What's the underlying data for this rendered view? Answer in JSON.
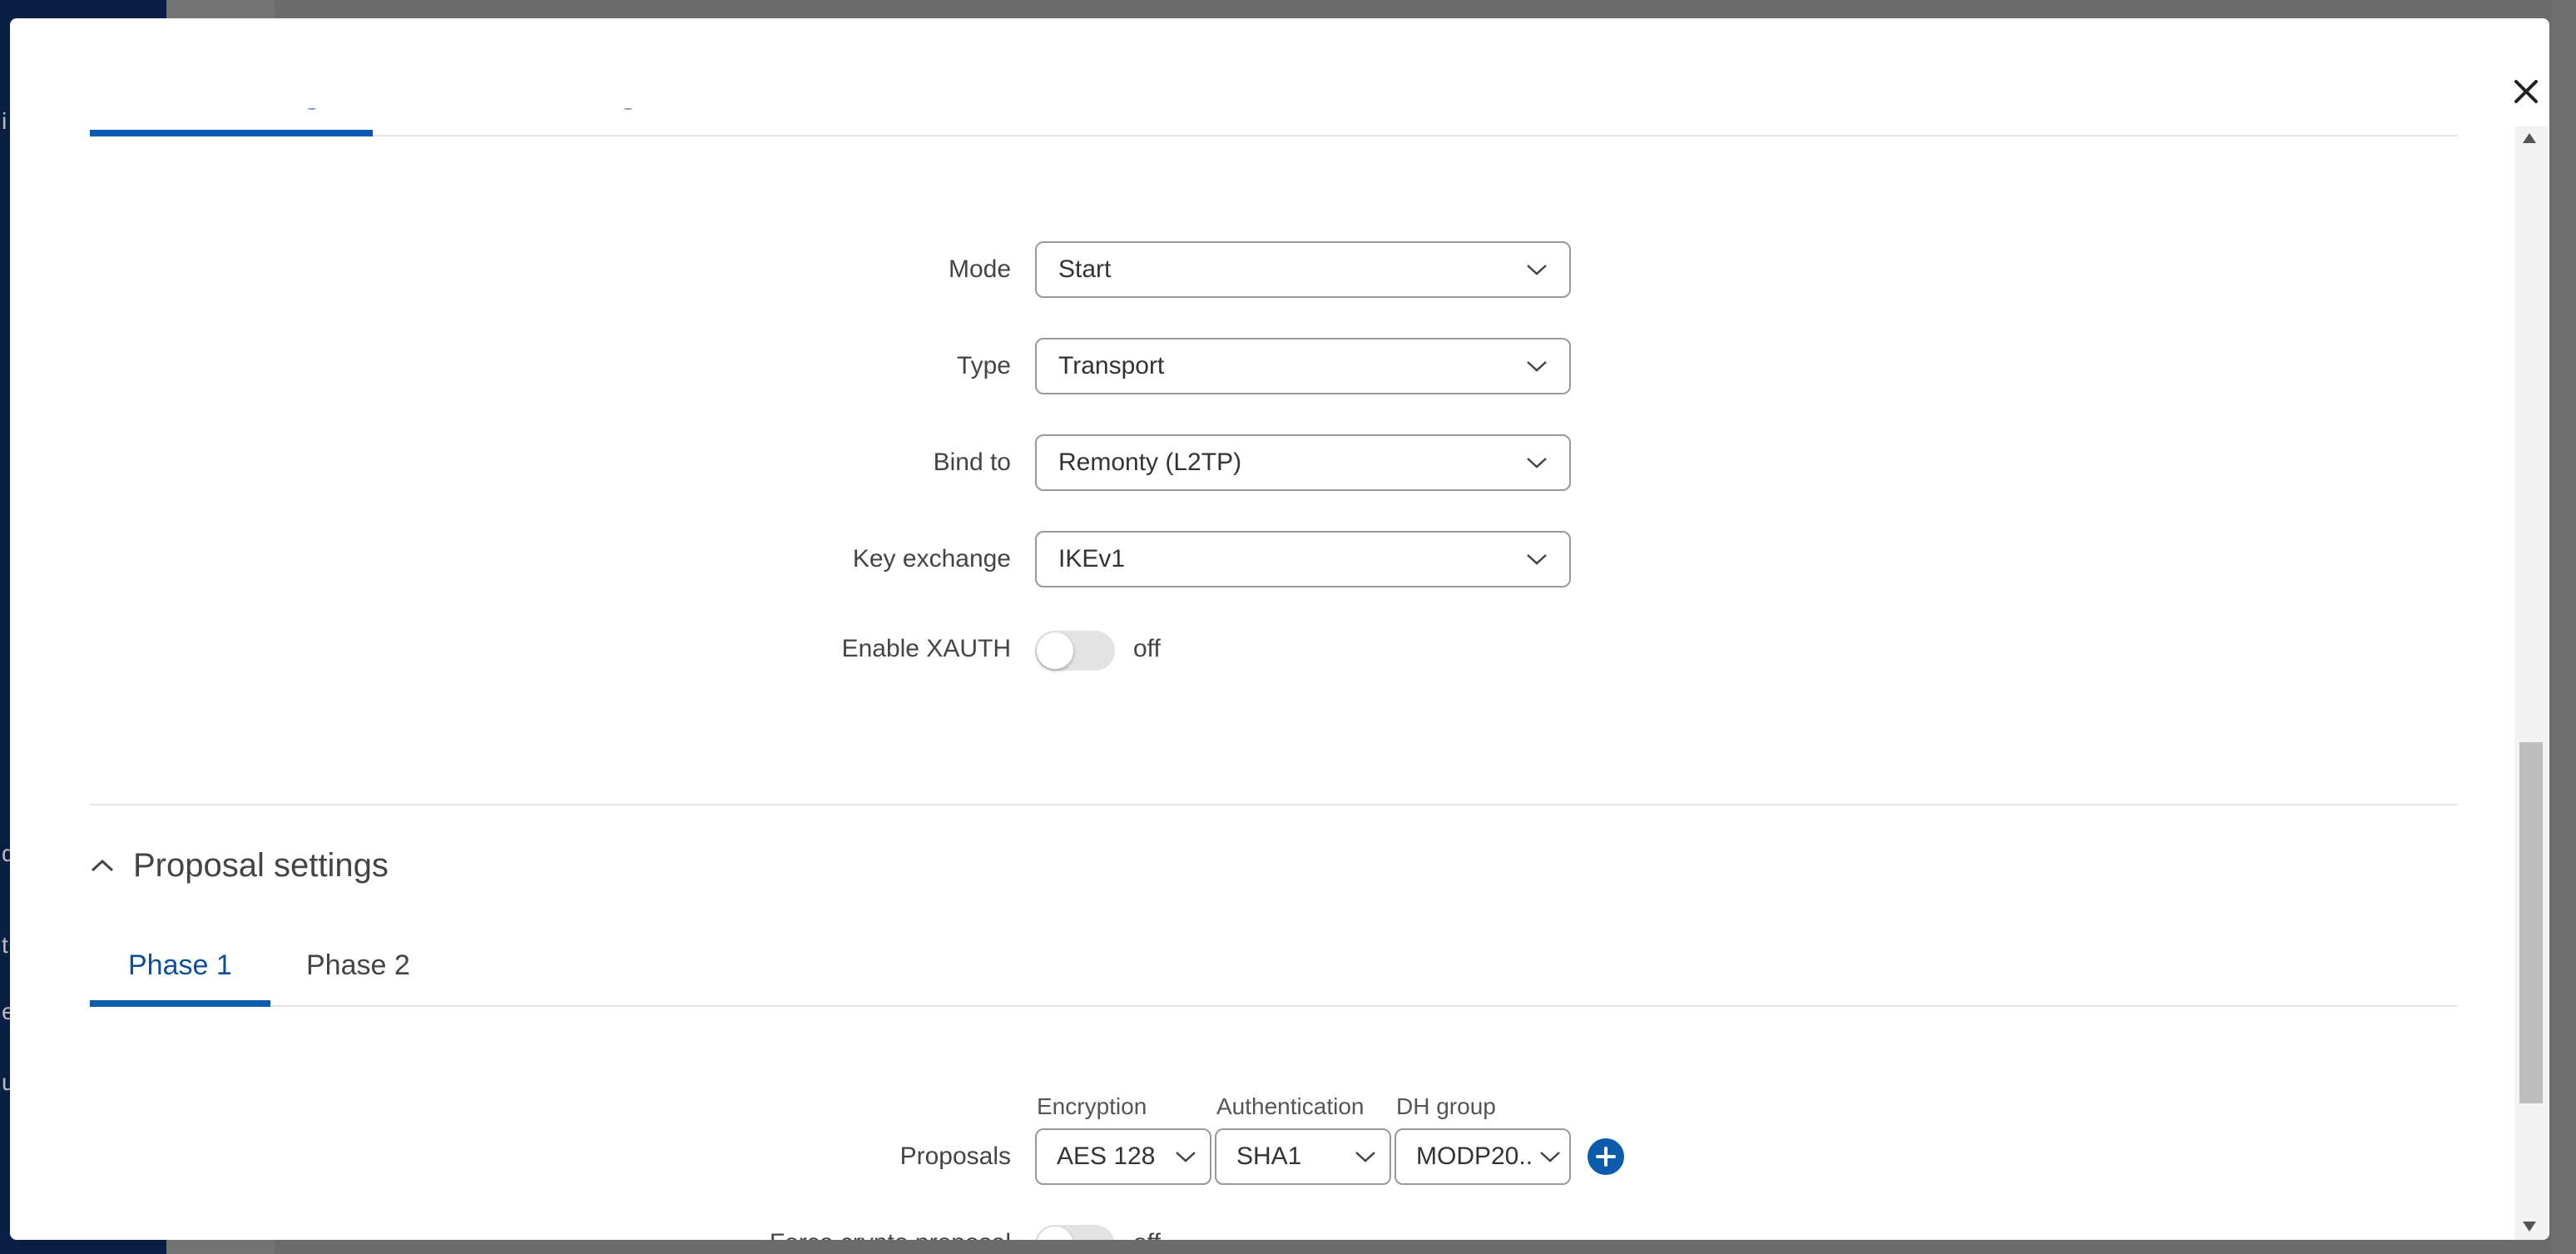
{
  "background": {
    "letters": [
      "i",
      "d",
      "t",
      "e",
      "u"
    ]
  },
  "modal": {
    "close_label": "×",
    "general_tabs": [
      {
        "label": "General settings",
        "active": true
      },
      {
        "label": "Advanced settings",
        "active": false
      }
    ],
    "general": {
      "mode": {
        "label": "Mode",
        "value": "Start"
      },
      "type": {
        "label": "Type",
        "value": "Transport"
      },
      "bind_to": {
        "label": "Bind to",
        "value": "Remonty (L2TP)"
      },
      "key_exchange": {
        "label": "Key exchange",
        "value": "IKEv1"
      },
      "enable_xauth": {
        "label": "Enable XAUTH",
        "state": "off"
      }
    },
    "proposal_section": {
      "title": "Proposal settings",
      "tabs": [
        {
          "label": "Phase 1",
          "active": true
        },
        {
          "label": "Phase 2",
          "active": false
        }
      ],
      "proposals": {
        "label": "Proposals",
        "columns": {
          "encryption": "Encryption",
          "authentication": "Authentication",
          "dh_group": "DH group"
        },
        "values": {
          "encryption": "AES 128",
          "authentication": "SHA1",
          "dh_group": "MODP20..."
        }
      },
      "force_crypto": {
        "label": "Force crypto proposal",
        "state": "off"
      }
    }
  },
  "colors": {
    "accent": "#0b5cad",
    "sidebar": "#0a1f44",
    "overlay": "#6b6b6b"
  }
}
